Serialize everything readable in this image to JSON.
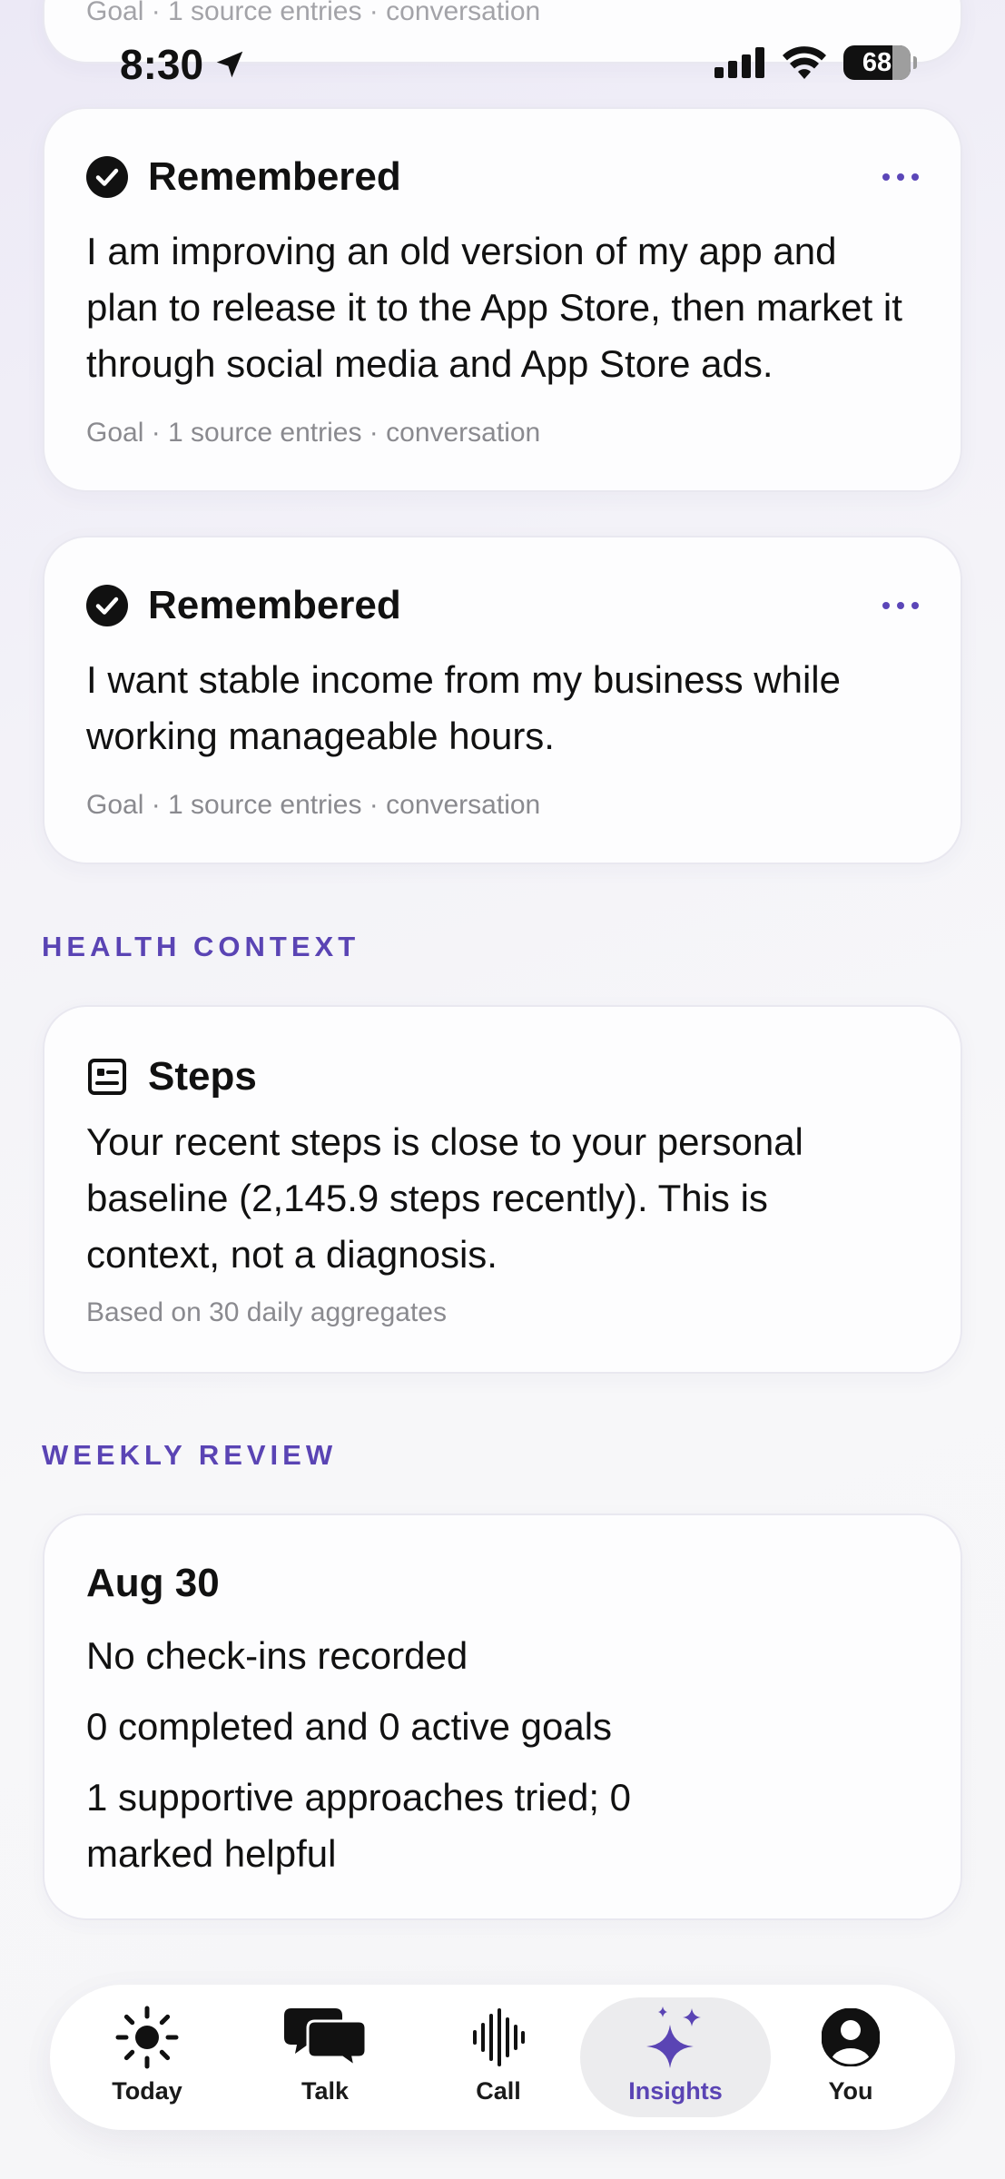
{
  "status_bar": {
    "time": "8:30",
    "battery": "68",
    "icons": [
      "location-arrow-icon",
      "cellular-signal-icon",
      "wifi-icon",
      "battery-icon"
    ]
  },
  "top_partial_card": {
    "meta": "Goal · 1 source entries · conversation"
  },
  "goals": [
    {
      "title": "Remembered",
      "text": "I am improving an old version of my app and plan to release it to the App Store, then market it through social media and App Store ads.",
      "meta": "Goal · 1 source entries · conversation"
    },
    {
      "title": "Remembered",
      "text": "I want stable income from my business while working manageable hours.",
      "meta": "Goal · 1 source entries · conversation"
    }
  ],
  "health": {
    "section_label": "HEALTH CONTEXT",
    "title": "Steps",
    "text": "Your recent steps is close to your personal baseline (2,145.9 steps recently). This is context, not a diagnosis.",
    "meta": "Based on 30 daily aggregates"
  },
  "weekly": {
    "section_label": "WEEKLY REVIEW",
    "date": "Aug 30",
    "lines": [
      "No check-ins recorded",
      "0 completed and 0 active goals",
      "1 supportive approaches tried; 0 marked helpful"
    ]
  },
  "tabs": [
    {
      "label": "Today",
      "icon": "sun-icon",
      "active": false
    },
    {
      "label": "Talk",
      "icon": "chat-bubbles-icon",
      "active": false
    },
    {
      "label": "Call",
      "icon": "waveform-icon",
      "active": false
    },
    {
      "label": "Insights",
      "icon": "sparkles-icon",
      "active": true
    },
    {
      "label": "You",
      "icon": "person-circle-icon",
      "active": false
    }
  ],
  "colors": {
    "accent": "#5a44b4",
    "text": "#111111",
    "muted": "#8a8a8f",
    "card_background": "#fdfdfe"
  }
}
